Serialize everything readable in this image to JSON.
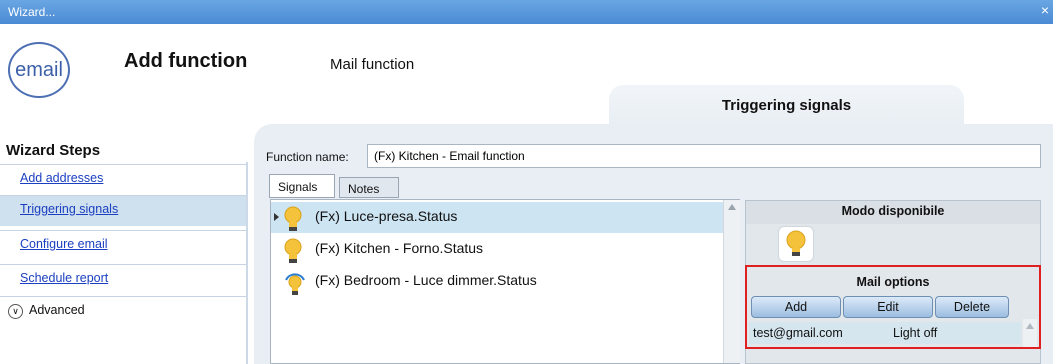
{
  "window": {
    "title": "Wizard...",
    "close": "×"
  },
  "header": {
    "logo_text": "email",
    "title": "Add function",
    "subtitle": "Mail function",
    "ribbon_tab": "Triggering signals"
  },
  "wizard": {
    "title": "Wizard Steps",
    "steps": [
      {
        "label": "Add addresses",
        "active": false
      },
      {
        "label": "Triggering signals",
        "active": true
      },
      {
        "label": "Configure email",
        "active": false
      },
      {
        "label": "Schedule report",
        "active": false
      }
    ],
    "advanced": "Advanced"
  },
  "form": {
    "function_name_label": "Function name:",
    "function_name_value": "(Fx) Kitchen - Email function"
  },
  "tabs": [
    {
      "label": "Signals"
    },
    {
      "label": "Notes"
    }
  ],
  "signals": [
    {
      "label": "(Fx) Luce-presa.Status",
      "icon": "bulb-icon"
    },
    {
      "label": "(Fx) Kitchen - Forno.Status",
      "icon": "bulb-icon"
    },
    {
      "label": "(Fx) Bedroom - Luce dimmer.Status",
      "icon": "dimmer-bulb-icon"
    }
  ],
  "modo": {
    "title": "Modo disponibile"
  },
  "mail_options": {
    "title": "Mail options",
    "buttons": {
      "add": "Add",
      "edit": "Edit",
      "delete": "Delete"
    },
    "rows": [
      {
        "email": "test@gmail.com",
        "state": "Light off"
      }
    ]
  },
  "colors": {
    "titlebar": "#5596dc",
    "highlight": "#e02020",
    "selected_row": "#cde4f2"
  }
}
